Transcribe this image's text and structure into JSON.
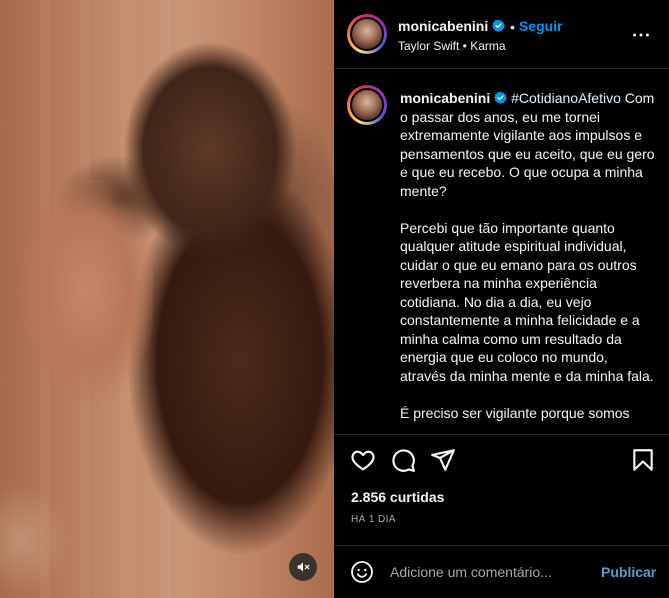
{
  "post": {
    "media": {
      "mute_icon": "speaker-muted-icon"
    },
    "header": {
      "username": "monicabenini",
      "separator": "•",
      "follow_label": "Seguir",
      "audio": "Taylor Swift • Karma",
      "more_icon": "more-options-icon"
    },
    "caption": {
      "username": "monicabenini",
      "hashtag": "#CotidianoAfetivo",
      "paragraph1": "Com o passar dos anos, eu me tornei extremamente vigilante aos impulsos e pensamentos que eu aceito, que eu gero e que eu recebo. O que ocupa a minha mente?",
      "paragraph2": "Percebi que tão importante quanto qualquer atitude espiritual individual, cuidar o que eu emano para os outros reverbera na minha experiência cotidiana. No dia a dia, eu vejo constantemente a minha felicidade e a minha calma como um resultado da energia que eu coloco no mundo, através da minha mente e da minha fala.",
      "paragraph3": "É preciso ser vigilante porque somos"
    },
    "actions": {
      "icons": [
        "heart-icon",
        "comment-icon",
        "share-icon",
        "bookmark-icon"
      ]
    },
    "likes": "2.856 curtidas",
    "time": "HÁ 1 DIA",
    "comment": {
      "placeholder": "Adicione um comentário...",
      "publish_label": "Publicar"
    }
  },
  "colors": {
    "background": "#000000",
    "text": "#f5f5f5",
    "link_blue": "#0095f6",
    "publish_blue": "#5f9ccf",
    "muted": "#a8a8a8",
    "divider": "#262626"
  }
}
